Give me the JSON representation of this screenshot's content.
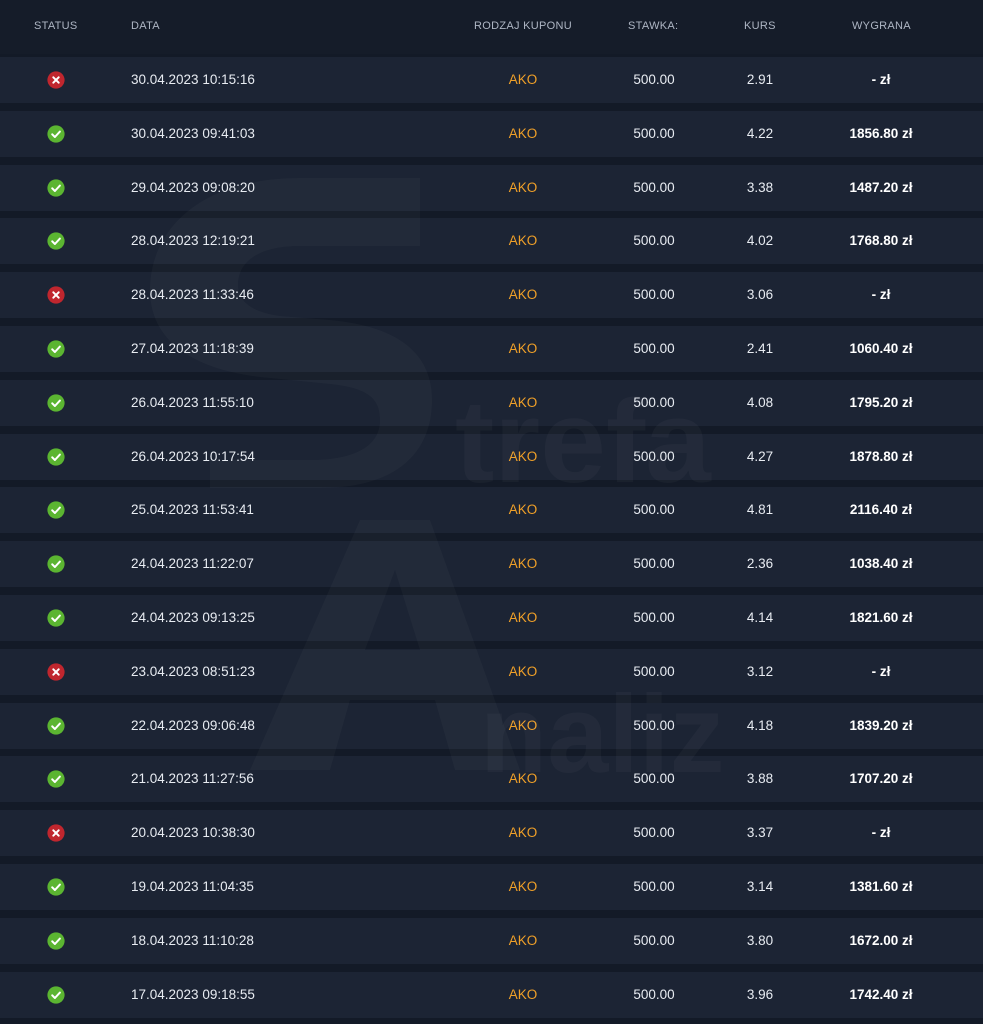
{
  "columns": {
    "status": "STATUS",
    "date": "DATA",
    "coupon_type": "RODZAJ KUPONU",
    "stake": "STAWKA:",
    "odds": "KURS",
    "win": "WYGRANA"
  },
  "colors": {
    "background": "#131a27",
    "row": "#1c2434",
    "accent": "#f0a028",
    "won": "#5bb531",
    "lost": "#c0262e"
  },
  "rows": [
    {
      "status": "lost",
      "status_icon": "x-circle-icon",
      "date": "30.04.2023 10:15:16",
      "type": "AKO",
      "stake": "500.00",
      "odds": "2.91",
      "win": "- zł"
    },
    {
      "status": "won",
      "status_icon": "check-circle-icon",
      "date": "30.04.2023 09:41:03",
      "type": "AKO",
      "stake": "500.00",
      "odds": "4.22",
      "win": "1856.80 zł"
    },
    {
      "status": "won",
      "status_icon": "check-circle-icon",
      "date": "29.04.2023 09:08:20",
      "type": "AKO",
      "stake": "500.00",
      "odds": "3.38",
      "win": "1487.20 zł"
    },
    {
      "status": "won",
      "status_icon": "check-circle-icon",
      "date": "28.04.2023 12:19:21",
      "type": "AKO",
      "stake": "500.00",
      "odds": "4.02",
      "win": "1768.80 zł"
    },
    {
      "status": "lost",
      "status_icon": "x-circle-icon",
      "date": "28.04.2023 11:33:46",
      "type": "AKO",
      "stake": "500.00",
      "odds": "3.06",
      "win": "- zł"
    },
    {
      "status": "won",
      "status_icon": "check-circle-icon",
      "date": "27.04.2023 11:18:39",
      "type": "AKO",
      "stake": "500.00",
      "odds": "2.41",
      "win": "1060.40 zł"
    },
    {
      "status": "won",
      "status_icon": "check-circle-icon",
      "date": "26.04.2023 11:55:10",
      "type": "AKO",
      "stake": "500.00",
      "odds": "4.08",
      "win": "1795.20 zł"
    },
    {
      "status": "won",
      "status_icon": "check-circle-icon",
      "date": "26.04.2023 10:17:54",
      "type": "AKO",
      "stake": "500.00",
      "odds": "4.27",
      "win": "1878.80 zł"
    },
    {
      "status": "won",
      "status_icon": "check-circle-icon",
      "date": "25.04.2023 11:53:41",
      "type": "AKO",
      "stake": "500.00",
      "odds": "4.81",
      "win": "2116.40 zł"
    },
    {
      "status": "won",
      "status_icon": "check-circle-icon",
      "date": "24.04.2023 11:22:07",
      "type": "AKO",
      "stake": "500.00",
      "odds": "2.36",
      "win": "1038.40 zł"
    },
    {
      "status": "won",
      "status_icon": "check-circle-icon",
      "date": "24.04.2023 09:13:25",
      "type": "AKO",
      "stake": "500.00",
      "odds": "4.14",
      "win": "1821.60 zł"
    },
    {
      "status": "lost",
      "status_icon": "x-circle-icon",
      "date": "23.04.2023 08:51:23",
      "type": "AKO",
      "stake": "500.00",
      "odds": "3.12",
      "win": "- zł"
    },
    {
      "status": "won",
      "status_icon": "check-circle-icon",
      "date": "22.04.2023 09:06:48",
      "type": "AKO",
      "stake": "500.00",
      "odds": "4.18",
      "win": "1839.20 zł"
    },
    {
      "status": "won",
      "status_icon": "check-circle-icon",
      "date": "21.04.2023 11:27:56",
      "type": "AKO",
      "stake": "500.00",
      "odds": "3.88",
      "win": "1707.20 zł"
    },
    {
      "status": "lost",
      "status_icon": "x-circle-icon",
      "date": "20.04.2023 10:38:30",
      "type": "AKO",
      "stake": "500.00",
      "odds": "3.37",
      "win": "- zł"
    },
    {
      "status": "won",
      "status_icon": "check-circle-icon",
      "date": "19.04.2023 11:04:35",
      "type": "AKO",
      "stake": "500.00",
      "odds": "3.14",
      "win": "1381.60 zł"
    },
    {
      "status": "won",
      "status_icon": "check-circle-icon",
      "date": "18.04.2023 11:10:28",
      "type": "AKO",
      "stake": "500.00",
      "odds": "3.80",
      "win": "1672.00 zł"
    },
    {
      "status": "won",
      "status_icon": "check-circle-icon",
      "date": "17.04.2023 09:18:55",
      "type": "AKO",
      "stake": "500.00",
      "odds": "3.96",
      "win": "1742.40 zł"
    }
  ],
  "watermark": {
    "word_top": "trefa",
    "word_bottom": "naliz"
  }
}
